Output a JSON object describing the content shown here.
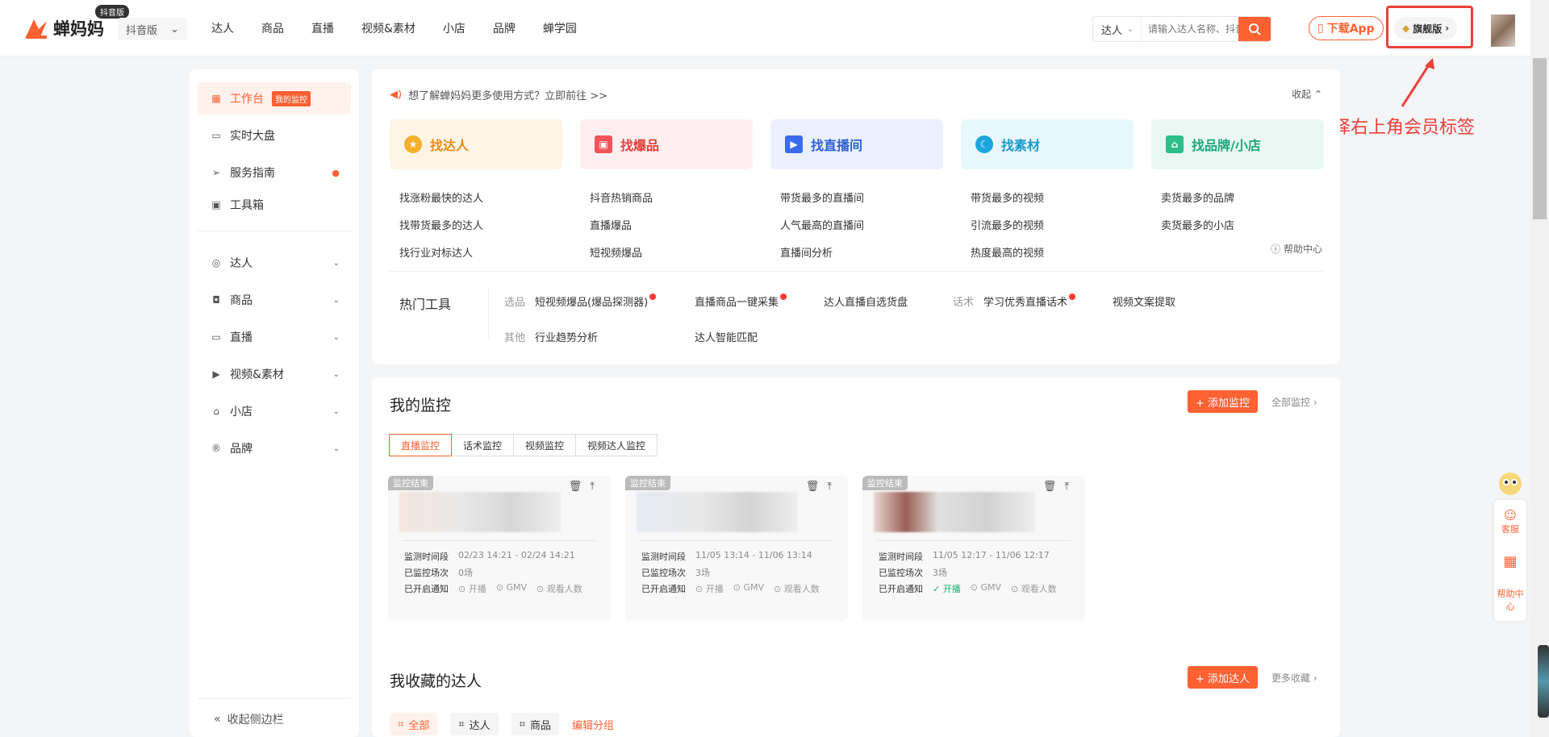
{
  "header": {
    "logo_text": "蝉妈妈",
    "logo_badge": "抖音版",
    "version_label": "抖音版",
    "nav": [
      "达人",
      "商品",
      "直播",
      "视频&素材",
      "小店",
      "品牌",
      "蝉学园"
    ],
    "search": {
      "type": "达人",
      "placeholder": "请输入达人名称、抖音号"
    },
    "download_label": "下载App",
    "vip_label": "旗舰版"
  },
  "annotation": {
    "text": "选择右上角会员标签",
    "color": "#e8403a"
  },
  "sidebar": {
    "items": [
      {
        "label": "工作台",
        "badge": "我的监控"
      },
      {
        "label": "实时大盘"
      },
      {
        "label": "服务指南"
      },
      {
        "label": "工具箱"
      }
    ],
    "groups": [
      "达人",
      "商品",
      "直播",
      "视频&素材",
      "小店",
      "品牌"
    ],
    "collapse_label": "收起侧边栏"
  },
  "workbench": {
    "notice": "想了解蝉妈妈更多使用方式？立即前往 >>",
    "collapse": "收起",
    "finders": [
      {
        "label": "找达人",
        "links": [
          "找涨粉最快的达人",
          "找带货最多的达人",
          "找行业对标达人"
        ]
      },
      {
        "label": "找爆品",
        "links": [
          "抖音热销商品",
          "直播爆品",
          "短视频爆品"
        ]
      },
      {
        "label": "找直播间",
        "links": [
          "带货最多的直播间",
          "人气最高的直播间",
          "直播间分析"
        ]
      },
      {
        "label": "找素材",
        "links": [
          "带货最多的视频",
          "引流最多的视频",
          "热度最高的视频"
        ]
      },
      {
        "label": "找品牌/小店",
        "links": [
          "卖货最多的品牌",
          "卖货最多的小店"
        ]
      }
    ],
    "help_center": "帮助中心",
    "hot_tools": {
      "title": "热门工具",
      "row1": {
        "cat1": "选品",
        "item1": "短视频爆品(爆品探测器)",
        "item2": "直播商品一键采集",
        "item3": "达人直播自选货盘",
        "cat2": "话术",
        "item4": "学习优秀直播话术",
        "item5": "视频文案提取"
      },
      "row2": {
        "cat": "其他",
        "item1": "行业趋势分析",
        "item2": "达人智能匹配"
      }
    }
  },
  "monitor": {
    "title": "我的监控",
    "add_label": "+ 添加监控",
    "all_label": "全部监控",
    "tabs": [
      "直播监控",
      "话术监控",
      "视频监控",
      "视频达人监控"
    ],
    "row_labels": {
      "period": "监测时间段",
      "count": "已监控场次",
      "notify": "已开启通知"
    },
    "notify_options": [
      "开播",
      "GMV",
      "观看人数"
    ],
    "cards": [
      {
        "status": "监控结束",
        "period": "02/23 14:21 - 02/24 14:21",
        "count": "0场",
        "start_on": false
      },
      {
        "status": "监控结束",
        "period": "11/05 13:14 - 11/06 13:14",
        "count": "3场",
        "start_on": false
      },
      {
        "status": "监控结束",
        "period": "11/05 12:17 - 11/06 12:17",
        "count": "3场",
        "start_on": true
      }
    ]
  },
  "favorites": {
    "title": "我收藏的达人",
    "add_label": "+ 添加达人",
    "more_label": "更多收藏",
    "tags": [
      "全部",
      "达人",
      "商品"
    ],
    "edit_label": "编辑分组"
  },
  "float_panel": {
    "service": "客服",
    "help": "帮助中心"
  },
  "colors": {
    "accent": "#ff6133",
    "highlight": "#e8403a"
  }
}
